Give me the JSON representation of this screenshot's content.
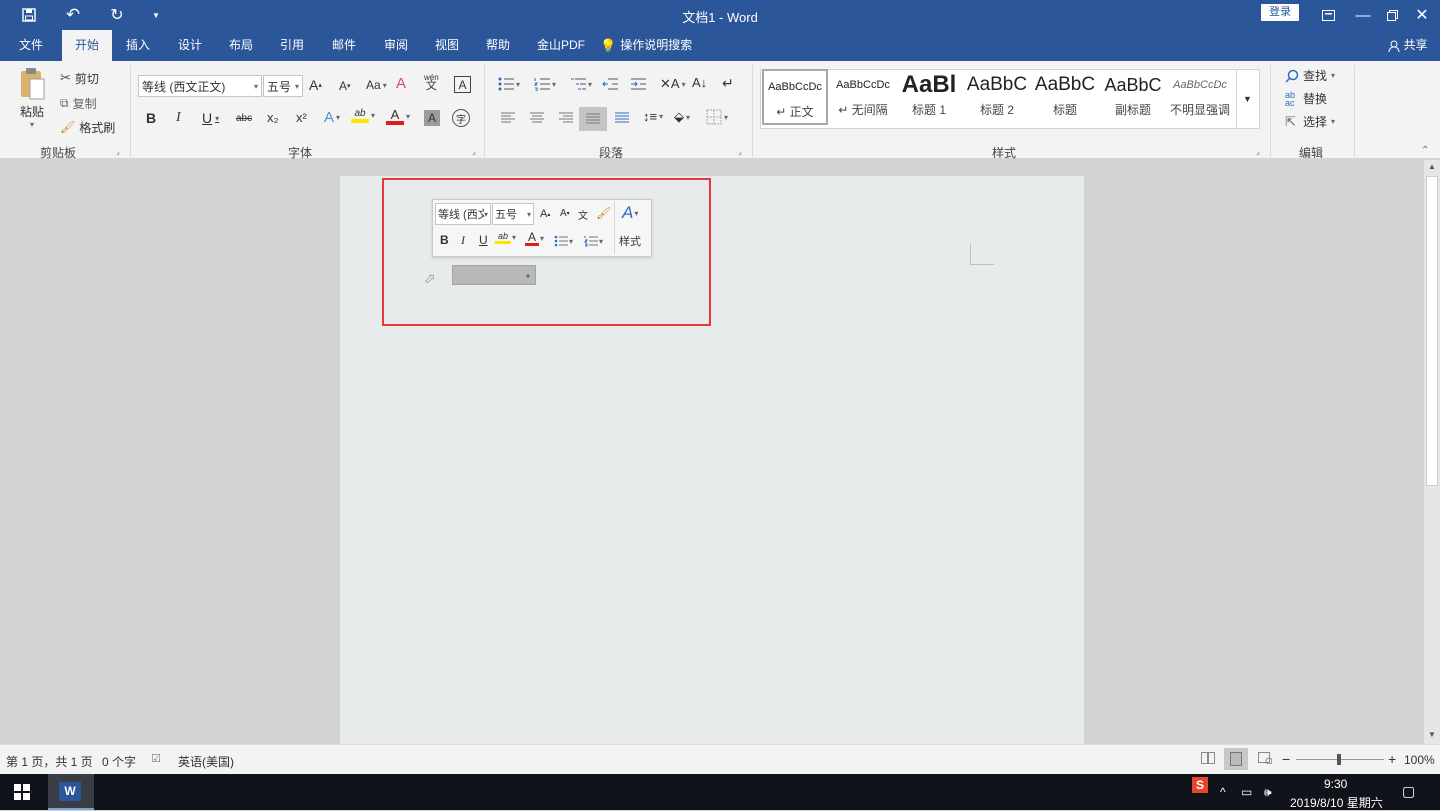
{
  "window": {
    "title": "文档1  -  Word",
    "login": "登录"
  },
  "tabs": [
    "文件",
    "开始",
    "插入",
    "设计",
    "布局",
    "引用",
    "邮件",
    "审阅",
    "视图",
    "帮助",
    "金山PDF"
  ],
  "tell_me": "操作说明搜索",
  "share": "共享",
  "clipboard": {
    "paste": "粘贴",
    "cut": "剪切",
    "copy": "复制",
    "format_painter": "格式刷",
    "label": "剪贴板"
  },
  "font": {
    "name": "等线 (西文正文)",
    "size": "五号",
    "label": "字体",
    "pinyin": "wén",
    "sub": "x₂",
    "sup": "x²",
    "abc": "abc",
    "aa": "Aa"
  },
  "paragraph": {
    "label": "段落"
  },
  "styles": {
    "label": "样式",
    "items": [
      {
        "sample": "AaBbCcDc",
        "name": "↵ 正文"
      },
      {
        "sample": "AaBbCcDc",
        "name": "↵ 无间隔"
      },
      {
        "sample": "AaBl",
        "name": "标题 1"
      },
      {
        "sample": "AaBbC",
        "name": "标题 2"
      },
      {
        "sample": "AaBbC",
        "name": "标题"
      },
      {
        "sample": "AaBbC",
        "name": "副标题"
      },
      {
        "sample": "AaBbCcDc",
        "name": "不明显强调"
      }
    ]
  },
  "editing": {
    "find": "查找",
    "replace": "替换",
    "select": "选择",
    "label": "编辑"
  },
  "mini_toolbar": {
    "font": "等线 (西文",
    "size": "五号",
    "styles": "样式"
  },
  "status": {
    "page": "第 1 页，共 1 页",
    "words": "0 个字",
    "language": "英语(美国)",
    "zoom": "100%"
  },
  "taskbar": {
    "time": "9:30",
    "date": "2019/8/10 星期六"
  }
}
